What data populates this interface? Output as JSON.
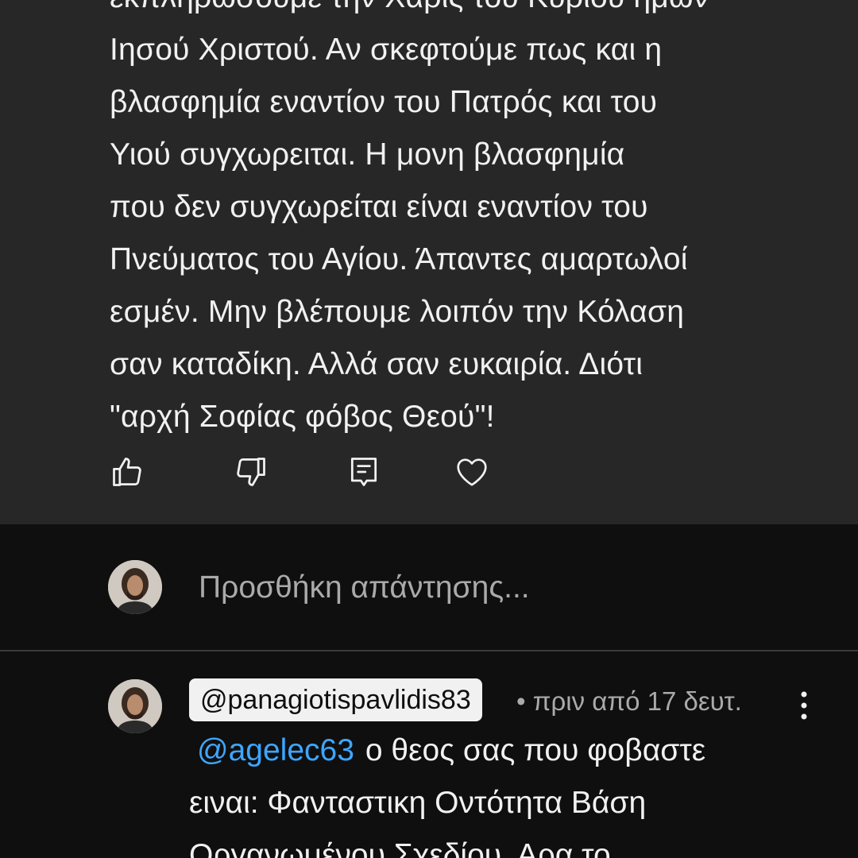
{
  "parent_comment": {
    "lines": [
      "εκπληρώσουμε την Χάρις του Κυρίου ημών",
      "Ιησού Χριστού. Αν σκεφτούμε πως και η",
      "βλασφημία εναντίον του Πατρός και του",
      "Υιού συγχωρειται. Η μονη βλασφημία",
      "που δεν συγχωρείται είναι εναντίον του",
      "Πνεύματος του Αγίου. Άπαντες αμαρτωλοί",
      "εσμέν. Μην βλέπουμε λοιπόν την Κόλαση",
      "σαν καταδίκη. Αλλά σαν ευκαιρία. Διότι",
      "\"αρχή Σοφίας φόβος Θεού\"!"
    ],
    "actions": [
      {
        "name": "like",
        "icon": "thumbs-up-icon"
      },
      {
        "name": "dislike",
        "icon": "thumbs-down-icon"
      },
      {
        "name": "reply",
        "icon": "comment-icon"
      },
      {
        "name": "heart",
        "icon": "heart-icon"
      }
    ]
  },
  "reply_box": {
    "placeholder": "Προσθήκη απάντησης..."
  },
  "reply": {
    "author": "@panagiotispavlidis83",
    "meta": "• πριν από 17 δευτ.",
    "mention": "@agelec63",
    "lines": [
      "ο θεος σας που φοβαστε",
      "ειναι: Φανταστικη Οντότητα Βάση",
      "Οργανωμένου Σχεδίου. Αρα το"
    ]
  },
  "colors": {
    "background": "#0f0f0f",
    "highlight": "#272727",
    "text": "#f1f1f1",
    "secondary_text": "#aaaaaa",
    "link": "#3ea6ff",
    "chip": "#f1f1f1"
  }
}
